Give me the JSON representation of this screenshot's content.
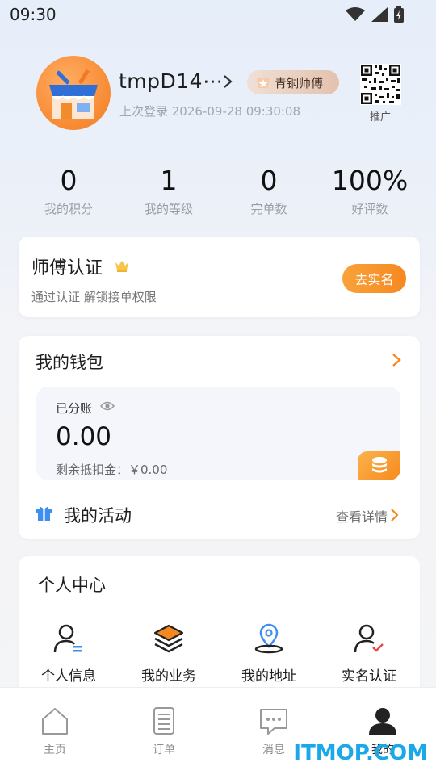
{
  "status_bar": {
    "time": "09:30"
  },
  "profile": {
    "username": "tmpD14⋯",
    "rank": "青铜师傅",
    "last_login": "上次登录 2026-09-28 09:30:08",
    "qrcode_label": "推广"
  },
  "stats": [
    {
      "value": "0",
      "label": "我的积分"
    },
    {
      "value": "1",
      "label": "我的等级"
    },
    {
      "value": "0",
      "label": "完单数"
    },
    {
      "value": "100%",
      "label": "好评数"
    }
  ],
  "certification": {
    "title": "师傅认证",
    "subtitle": "通过认证 解锁接单权限",
    "button": "去实名"
  },
  "wallet": {
    "title": "我的钱包",
    "split_label": "已分账",
    "balance": "0.00",
    "deduct": "剩余抵扣金：￥0.00",
    "activity_title": "我的活动",
    "activity_link": "查看详情"
  },
  "personal_center": {
    "title": "个人中心",
    "items": [
      {
        "label": "个人信息",
        "icon": "user-info-icon"
      },
      {
        "label": "我的业务",
        "icon": "layers-icon"
      },
      {
        "label": "我的地址",
        "icon": "location-pin-icon"
      },
      {
        "label": "实名认证",
        "icon": "user-verified-icon"
      }
    ]
  },
  "tab_bar": [
    {
      "label": "主页",
      "icon": "home-icon"
    },
    {
      "label": "订单",
      "icon": "order-icon"
    },
    {
      "label": "消息",
      "icon": "message-icon"
    },
    {
      "label": "我的",
      "icon": "profile-icon",
      "active": true
    }
  ],
  "watermark": "ITMOP.COM",
  "colors": {
    "accent": "#f68820",
    "active_tab": "#222222",
    "inactive_tab": "#8d8f94"
  }
}
